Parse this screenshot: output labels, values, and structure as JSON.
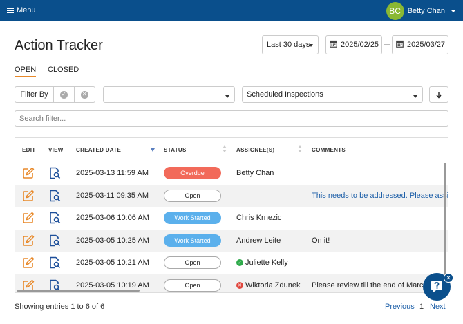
{
  "header": {
    "menu_label": "Menu",
    "user_initials": "BC",
    "user_name": "Betty Chan"
  },
  "page": {
    "title": "Action Tracker",
    "range_label": "Last 30 days",
    "date_from": "2025/02/25",
    "date_to": "2025/03/27"
  },
  "tabs": [
    {
      "label": "OPEN",
      "active": true
    },
    {
      "label": "CLOSED",
      "active": false
    }
  ],
  "filters": {
    "filter_by_label": "Filter By",
    "first_select_value": "",
    "second_select_value": "Scheduled Inspections",
    "search_placeholder": "Search filter..."
  },
  "table": {
    "columns": [
      "EDIT",
      "VIEW",
      "CREATED DATE",
      "STATUS",
      "ASSIGNEE(S)",
      "COMMENTS"
    ],
    "sorted_column": "CREATED DATE",
    "sort_direction": "descending",
    "rows": [
      {
        "created": "2025-03-13 11:59 AM",
        "status": "Overdue",
        "assignee": "Betty Chan",
        "assignee_state": "",
        "comment": ""
      },
      {
        "created": "2025-03-11 09:35 AM",
        "status": "Open",
        "assignee": "",
        "assignee_state": "",
        "comment": "This needs to be addressed. Please assign"
      },
      {
        "created": "2025-03-06 10:06 AM",
        "status": "Work Started",
        "assignee": "Chris Krnezic",
        "assignee_state": "",
        "comment": ""
      },
      {
        "created": "2025-03-05 10:25 AM",
        "status": "Work Started",
        "assignee": "Andrew Leite",
        "assignee_state": "",
        "comment": "On it!"
      },
      {
        "created": "2025-03-05 10:21 AM",
        "status": "Open",
        "assignee": "Juliette Kelly",
        "assignee_state": "accepted",
        "comment": ""
      },
      {
        "created": "2025-03-05 10:19 AM",
        "status": "Open",
        "assignee": "Wiktoria Zdunek",
        "assignee_state": "declined",
        "comment": "Please review till the end of March"
      }
    ]
  },
  "footer": {
    "entries_text": "Showing entries 1 to 6 of 6",
    "prev_label": "Previous",
    "page_number": "1",
    "next_label": "Next"
  },
  "colors": {
    "header_bg": "#0a4f8c",
    "accent_orange": "#e8892a",
    "overdue": "#f26a5a",
    "work_started": "#5bb0ec",
    "link_blue": "#1d5fa8"
  },
  "icons": {
    "edit": "pencil-square-icon",
    "view": "document-search-icon",
    "help": "chat-help-icon"
  }
}
